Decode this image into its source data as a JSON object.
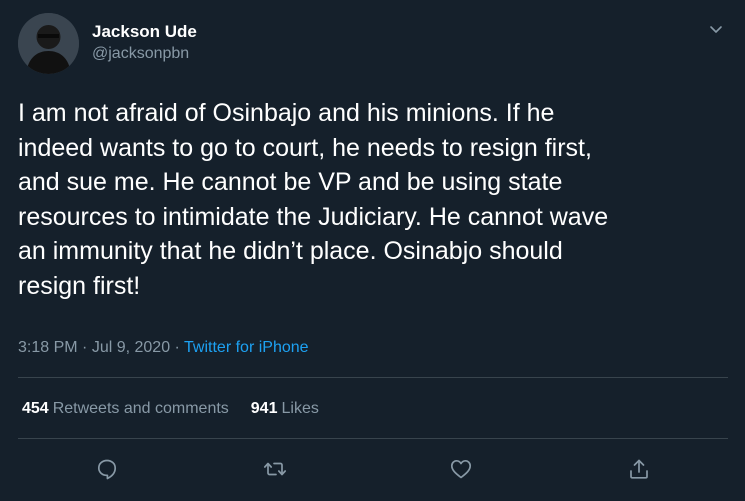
{
  "author": {
    "display_name": "Jackson Ude",
    "handle": "@jacksonpbn"
  },
  "tweet": {
    "text": "I am not afraid of Osinbajo and his minions. If he\nindeed wants to go to court, he needs to resign first,\nand sue me. He cannot be VP and be using state\nresources to intimidate the Judiciary. He cannot wave\nan immunity that he didn’t place. Osinabjo should\nresign first!",
    "time": "3:18 PM",
    "separator_1": " · ",
    "date": "Jul 9, 2020",
    "separator_2": " · ",
    "source": "Twitter for iPhone"
  },
  "stats": {
    "retweets_count": "454",
    "retweets_label": "Retweets and comments",
    "likes_count": "941",
    "likes_label": "Likes"
  },
  "icons": {
    "caret": "chevron-down-icon",
    "reply": "reply-icon",
    "retweet": "retweet-icon",
    "like": "heart-icon",
    "share": "share-icon"
  },
  "colors": {
    "background": "#15202b",
    "text_primary": "#ffffff",
    "text_secondary": "#8899a6",
    "accent": "#1da1f2",
    "divider": "#38444d"
  }
}
